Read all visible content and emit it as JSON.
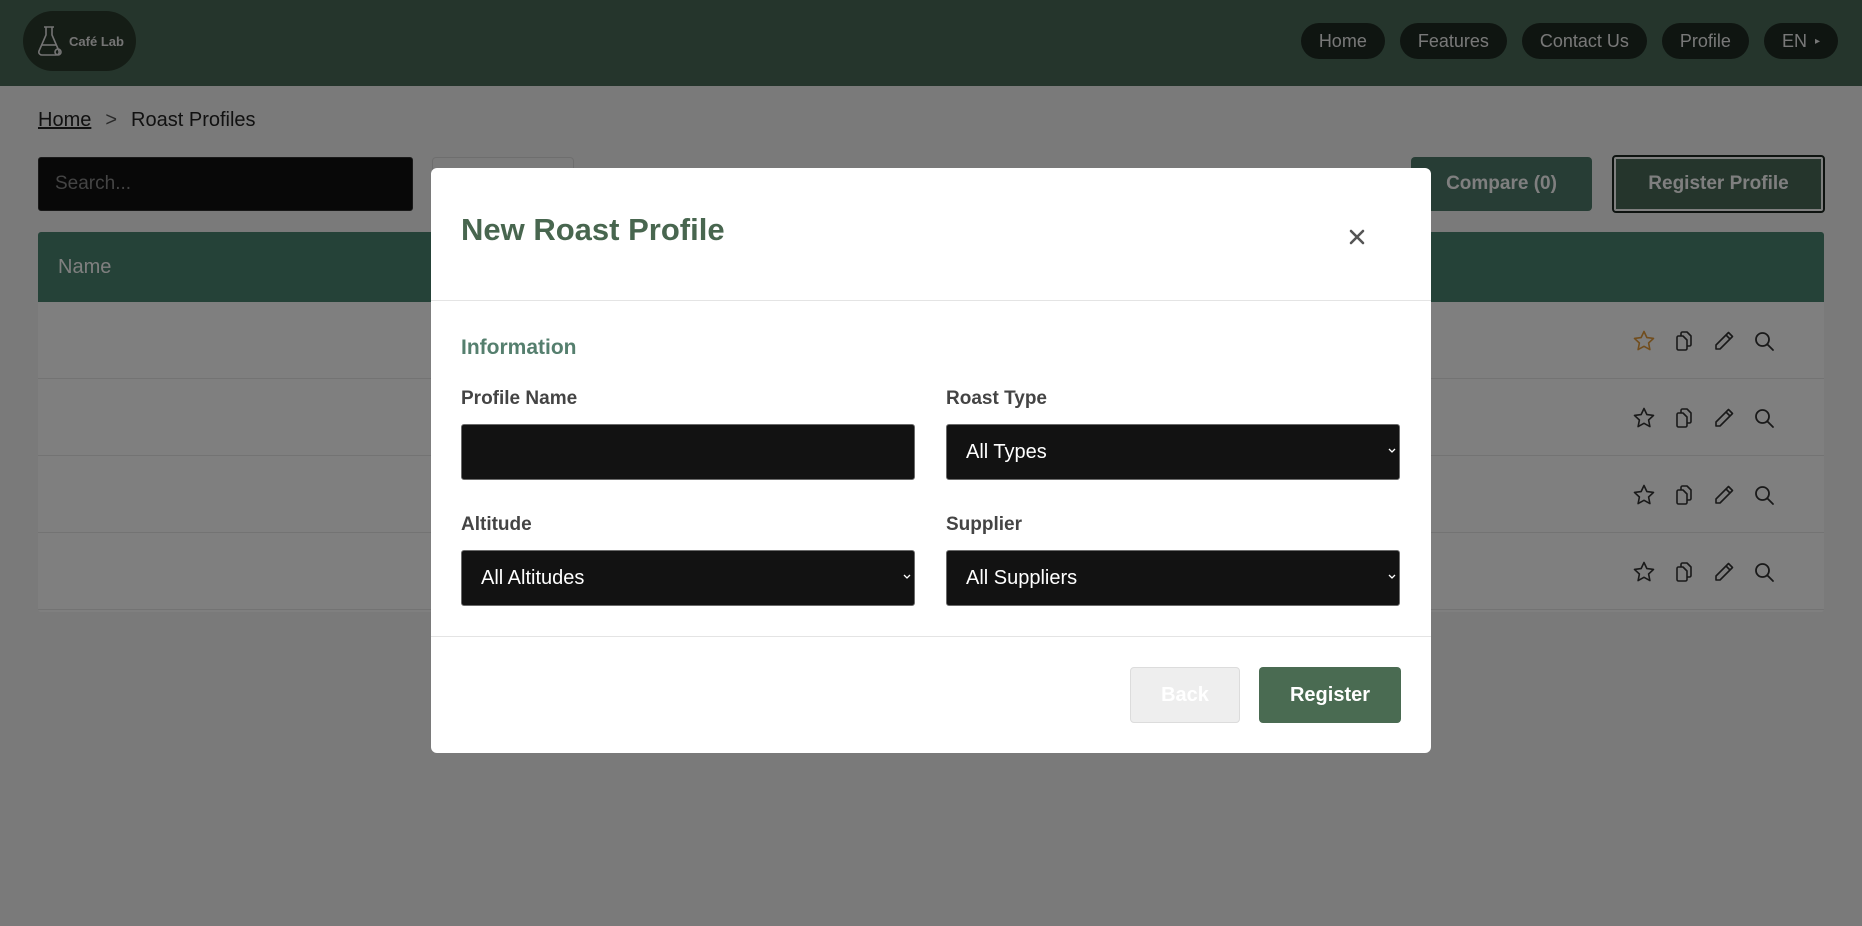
{
  "header": {
    "logo_text": "Café Lab",
    "nav": [
      {
        "label": "Home"
      },
      {
        "label": "Features"
      },
      {
        "label": "Contact Us"
      },
      {
        "label": "Profile"
      }
    ],
    "language": "EN"
  },
  "breadcrumb": {
    "home": "Home",
    "separator": ">",
    "current": "Roast Profiles"
  },
  "toolbar": {
    "search_placeholder": "Search...",
    "compare_label": "Compare (0)",
    "register_profile_label": "Register Profile"
  },
  "table": {
    "columns": [
      "Name"
    ],
    "rows": [
      {
        "favorite": true
      },
      {
        "favorite": false
      },
      {
        "favorite": false
      },
      {
        "favorite": false
      }
    ],
    "favorite_color": "#e39a3b"
  },
  "modal": {
    "title": "New Roast Profile",
    "section": "Information",
    "fields": {
      "profile_name": {
        "label": "Profile Name",
        "value": ""
      },
      "roast_type": {
        "label": "Roast Type",
        "value": "All Types"
      },
      "altitude": {
        "label": "Altitude",
        "value": "All Altitudes"
      },
      "supplier": {
        "label": "Supplier",
        "value": "All Suppliers"
      }
    },
    "back_label": "Back",
    "register_label": "Register"
  },
  "colors": {
    "brand": "#4a6b58",
    "accent": "#4a8570",
    "title": "#48664f"
  }
}
